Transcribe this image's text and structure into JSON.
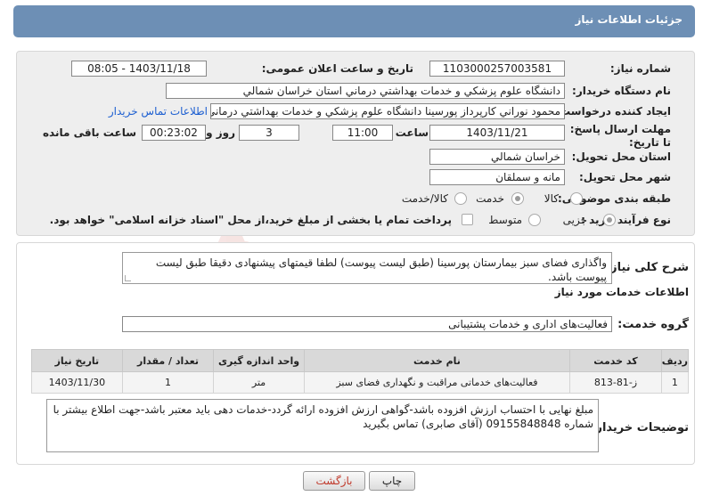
{
  "header": {
    "title": "جزئیات اطلاعات نیاز"
  },
  "fields": {
    "need_number_label": "شماره نیاز:",
    "need_number": "1103000257003581",
    "announce_label": "تاریخ و ساعت اعلان عمومی:",
    "announce_value": "1403/11/18 - 08:05",
    "buyer_label": "نام دستگاه خریدار:",
    "buyer_value": "دانشگاه علوم پزشکي و خدمات بهداشتي درماني استان خراسان شمالي",
    "creator_label": "ایجاد کننده درخواست:",
    "creator_value": "محمود نوراني کارپرداز پورسينا دانشگاه علوم پزشکي و خدمات بهداشتي درماني",
    "contact_link": "اطلاعات تماس خریدار",
    "deadline_label": "مهلت ارسال پاسخ: تا تاریخ:",
    "deadline_date": "1403/11/21",
    "time_label": "ساعت",
    "deadline_time": "11:00",
    "days_value": "3",
    "days_label": "روز و",
    "remaining_time": "00:23:02",
    "remaining_label": "ساعت باقی مانده",
    "province_label": "استان محل تحویل:",
    "province_value": "خراسان شمالي",
    "city_label": "شهر محل تحویل:",
    "city_value": "مانه و سملقان",
    "category_label": "طبقه بندی موضوعی:",
    "category_options": [
      "کالا",
      "خدمت",
      "کالا/خدمت"
    ],
    "category_selected": "خدمت",
    "process_label": "نوع فرآیند خرید :",
    "process_options": [
      "جزیی",
      "متوسط"
    ],
    "process_selected": "جزیی",
    "treasury_note": "پرداخت تمام یا بخشی از مبلغ خرید،از محل \"اسناد خزانه اسلامی\" خواهد بود."
  },
  "summary": {
    "label": "شرح کلی نیاز:",
    "text": "واگذاری فضای سبز بیمارستان پورسینا (طبق لیست پیوست) لطفا قیمتهای پیشنهادی دقیقا طبق لیست پیوست باشد."
  },
  "services_section": {
    "heading": "اطلاعات خدمات مورد نیاز",
    "group_label": "گروه خدمت:",
    "group_value": "فعالیت‌های اداری و خدمات پشتیبانی"
  },
  "table": {
    "columns": [
      "ردیف",
      "کد خدمت",
      "نام خدمت",
      "واحد اندازه گیری",
      "تعداد / مقدار",
      "تاریخ نیاز"
    ],
    "rows": [
      [
        "1",
        "ز-81-813",
        "فعالیت‌های خدماتی مراقبت و نگهداری فضای سبز",
        "متر",
        "1",
        "1403/11/30"
      ]
    ]
  },
  "buyer_notes": {
    "label": "توضیحات خریدار:",
    "text": "مبلغ نهایی با احتساب ارزش افزوده باشد-گواهی ارزش افزوده ارائه گردد-خدمات دهی باید معتبر باشد-جهت اطلاع بیشتر با شماره 09155848848  (آقای صابری) تماس بگیرید"
  },
  "buttons": {
    "print": "چاپ",
    "back": "بازگشت"
  },
  "watermark_text": "AriaTender.net",
  "colors": {
    "header": "#6d8fb5",
    "link": "#1d5fd1",
    "back_button_text": "#c0392b"
  }
}
